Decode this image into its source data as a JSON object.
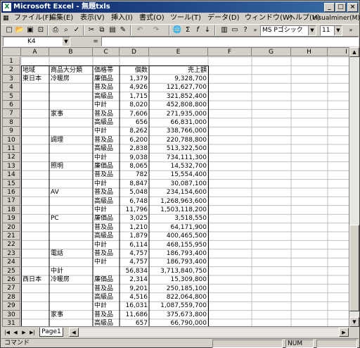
{
  "window": {
    "title": "Microsoft Excel - 無題txls"
  },
  "menubar": {
    "items": [
      "ファイル(F)",
      "編集(E)",
      "表示(V)",
      "挿入(I)",
      "書式(O)",
      "ツール(T)",
      "データ(D)",
      "ウィンドウ(W)",
      "ヘルプ(H)",
      "Visualminer(M)"
    ]
  },
  "toolbar": {
    "font_name": "MS Pゴシック",
    "font_size": "11"
  },
  "formula_bar": {
    "name_box": "K4",
    "equals": "=",
    "value": ""
  },
  "columns": [
    "A",
    "B",
    "C",
    "D",
    "E",
    "F",
    "G",
    "H",
    "I"
  ],
  "rows": [
    [
      "",
      "",
      "",
      "",
      ""
    ],
    [
      "地域",
      "商品大分類",
      "価格帯",
      "個数",
      "売上額"
    ],
    [
      "東日本",
      "冷暖房",
      "廉価品",
      "1,379",
      "9,328,700"
    ],
    [
      "",
      "",
      "普及品",
      "4,926",
      "121,627,700"
    ],
    [
      "",
      "",
      "高級品",
      "1,715",
      "321,852,400"
    ],
    [
      "",
      "",
      "中計",
      "8,020",
      "452,808,800"
    ],
    [
      "",
      "家事",
      "普及品",
      "7,606",
      "271,935,000"
    ],
    [
      "",
      "",
      "高級品",
      "656",
      "66,831,000"
    ],
    [
      "",
      "",
      "中計",
      "8,262",
      "338,766,000"
    ],
    [
      "",
      "調理",
      "普及品",
      "6,200",
      "220,788,800"
    ],
    [
      "",
      "",
      "高級品",
      "2,838",
      "513,322,500"
    ],
    [
      "",
      "",
      "中計",
      "9,038",
      "734,111,300"
    ],
    [
      "",
      "照明",
      "廉価品",
      "8,065",
      "14,532,700"
    ],
    [
      "",
      "",
      "普及品",
      "782",
      "15,554,400"
    ],
    [
      "",
      "",
      "中計",
      "8,847",
      "30,087,100"
    ],
    [
      "",
      "AV",
      "普及品",
      "5,048",
      "234,154,600"
    ],
    [
      "",
      "",
      "高級品",
      "6,748",
      "1,268,963,600"
    ],
    [
      "",
      "",
      "中計",
      "11,796",
      "1,503,118,200"
    ],
    [
      "",
      "PC",
      "廉価品",
      "3,025",
      "3,518,550"
    ],
    [
      "",
      "",
      "普及品",
      "1,210",
      "64,171,900"
    ],
    [
      "",
      "",
      "高級品",
      "1,879",
      "400,465,500"
    ],
    [
      "",
      "",
      "中計",
      "6,114",
      "468,155,950"
    ],
    [
      "",
      "電話",
      "普及品",
      "4,757",
      "186,793,400"
    ],
    [
      "",
      "",
      "中計",
      "4,757",
      "186,793,400"
    ],
    [
      "",
      "中計",
      "",
      "56,834",
      "3,713,840,750"
    ],
    [
      "西日本",
      "冷暖房",
      "廉価品",
      "2,314",
      "15,309,800"
    ],
    [
      "",
      "",
      "普及品",
      "9,201",
      "250,185,100"
    ],
    [
      "",
      "",
      "高級品",
      "4,516",
      "822,064,800"
    ],
    [
      "",
      "",
      "中計",
      "16,031",
      "1,087,559,700"
    ],
    [
      "",
      "家事",
      "普及品",
      "11,686",
      "375,673,800"
    ],
    [
      "",
      "",
      "高級品",
      "657",
      "66,790,000"
    ]
  ],
  "sheet_tab": "Page1",
  "status": {
    "mode": "コマンド",
    "num": "NUM"
  }
}
